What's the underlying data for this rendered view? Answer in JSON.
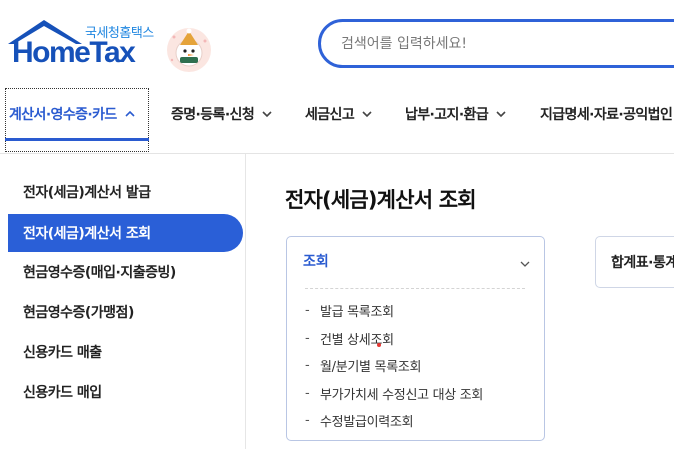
{
  "logo": {
    "subtitle": "국세청홈택스",
    "title": "HomeTax",
    "mascot_icon": "snowman-mascot-icon"
  },
  "search": {
    "placeholder": "검색어를 입력하세요!"
  },
  "topnav": {
    "items": [
      {
        "label": "계산서·영수증·카드",
        "active": true,
        "chevron": "chevron-up-icon"
      },
      {
        "label": "증명·등록·신청",
        "active": false,
        "chevron": "chevron-down-icon"
      },
      {
        "label": "세금신고",
        "active": false,
        "chevron": "chevron-down-icon"
      },
      {
        "label": "납부·고지·환급",
        "active": false,
        "chevron": "chevron-down-icon"
      },
      {
        "label": "지급명세·자료·공익법인",
        "active": false
      }
    ]
  },
  "sidebar": {
    "items": [
      {
        "label": "전자(세금)계산서 발급",
        "active": false
      },
      {
        "label": "전자(세금)계산서 조회",
        "active": true
      },
      {
        "label": "현금영수증(매입·지출증빙)",
        "active": false
      },
      {
        "label": "현금영수증(가맹점)",
        "active": false
      },
      {
        "label": "신용카드 매출",
        "active": false
      },
      {
        "label": "신용카드 매입",
        "active": false
      }
    ]
  },
  "main": {
    "title": "전자(세금)계산서 조회",
    "card": {
      "heading": "조회",
      "items": [
        "발급 목록조회",
        "건별 상세조회",
        "월/분기별 목록조회",
        "부가가치세 수정신고 대상 조회",
        "수정발급이력조회"
      ]
    },
    "card2": {
      "heading": "합계표·통계조회"
    }
  },
  "colors": {
    "brand_blue": "#2a5bd0",
    "logo_blue": "#1651b9",
    "active_bg": "#2a5fd7",
    "search_border": "#2f62d8"
  }
}
